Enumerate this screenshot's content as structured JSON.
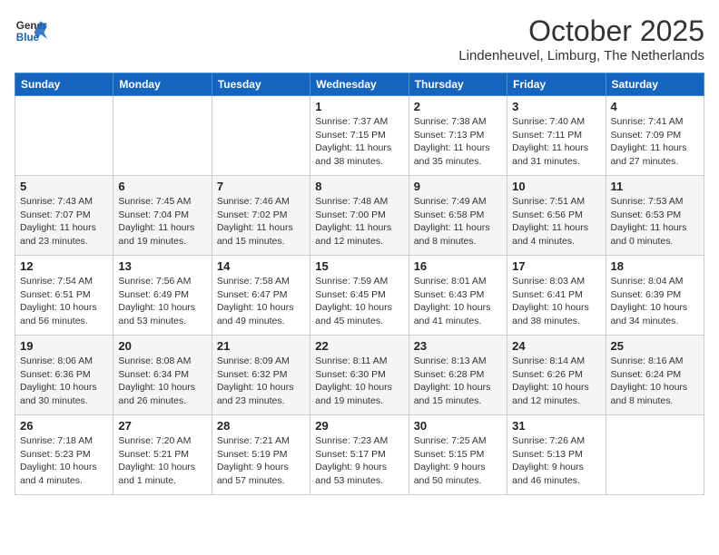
{
  "header": {
    "logo_line1": "General",
    "logo_line2": "Blue",
    "month": "October 2025",
    "location": "Lindenheuvel, Limburg, The Netherlands"
  },
  "weekdays": [
    "Sunday",
    "Monday",
    "Tuesday",
    "Wednesday",
    "Thursday",
    "Friday",
    "Saturday"
  ],
  "weeks": [
    [
      {
        "day": "",
        "info": ""
      },
      {
        "day": "",
        "info": ""
      },
      {
        "day": "",
        "info": ""
      },
      {
        "day": "1",
        "info": "Sunrise: 7:37 AM\nSunset: 7:15 PM\nDaylight: 11 hours\nand 38 minutes."
      },
      {
        "day": "2",
        "info": "Sunrise: 7:38 AM\nSunset: 7:13 PM\nDaylight: 11 hours\nand 35 minutes."
      },
      {
        "day": "3",
        "info": "Sunrise: 7:40 AM\nSunset: 7:11 PM\nDaylight: 11 hours\nand 31 minutes."
      },
      {
        "day": "4",
        "info": "Sunrise: 7:41 AM\nSunset: 7:09 PM\nDaylight: 11 hours\nand 27 minutes."
      }
    ],
    [
      {
        "day": "5",
        "info": "Sunrise: 7:43 AM\nSunset: 7:07 PM\nDaylight: 11 hours\nand 23 minutes."
      },
      {
        "day": "6",
        "info": "Sunrise: 7:45 AM\nSunset: 7:04 PM\nDaylight: 11 hours\nand 19 minutes."
      },
      {
        "day": "7",
        "info": "Sunrise: 7:46 AM\nSunset: 7:02 PM\nDaylight: 11 hours\nand 15 minutes."
      },
      {
        "day": "8",
        "info": "Sunrise: 7:48 AM\nSunset: 7:00 PM\nDaylight: 11 hours\nand 12 minutes."
      },
      {
        "day": "9",
        "info": "Sunrise: 7:49 AM\nSunset: 6:58 PM\nDaylight: 11 hours\nand 8 minutes."
      },
      {
        "day": "10",
        "info": "Sunrise: 7:51 AM\nSunset: 6:56 PM\nDaylight: 11 hours\nand 4 minutes."
      },
      {
        "day": "11",
        "info": "Sunrise: 7:53 AM\nSunset: 6:53 PM\nDaylight: 11 hours\nand 0 minutes."
      }
    ],
    [
      {
        "day": "12",
        "info": "Sunrise: 7:54 AM\nSunset: 6:51 PM\nDaylight: 10 hours\nand 56 minutes."
      },
      {
        "day": "13",
        "info": "Sunrise: 7:56 AM\nSunset: 6:49 PM\nDaylight: 10 hours\nand 53 minutes."
      },
      {
        "day": "14",
        "info": "Sunrise: 7:58 AM\nSunset: 6:47 PM\nDaylight: 10 hours\nand 49 minutes."
      },
      {
        "day": "15",
        "info": "Sunrise: 7:59 AM\nSunset: 6:45 PM\nDaylight: 10 hours\nand 45 minutes."
      },
      {
        "day": "16",
        "info": "Sunrise: 8:01 AM\nSunset: 6:43 PM\nDaylight: 10 hours\nand 41 minutes."
      },
      {
        "day": "17",
        "info": "Sunrise: 8:03 AM\nSunset: 6:41 PM\nDaylight: 10 hours\nand 38 minutes."
      },
      {
        "day": "18",
        "info": "Sunrise: 8:04 AM\nSunset: 6:39 PM\nDaylight: 10 hours\nand 34 minutes."
      }
    ],
    [
      {
        "day": "19",
        "info": "Sunrise: 8:06 AM\nSunset: 6:36 PM\nDaylight: 10 hours\nand 30 minutes."
      },
      {
        "day": "20",
        "info": "Sunrise: 8:08 AM\nSunset: 6:34 PM\nDaylight: 10 hours\nand 26 minutes."
      },
      {
        "day": "21",
        "info": "Sunrise: 8:09 AM\nSunset: 6:32 PM\nDaylight: 10 hours\nand 23 minutes."
      },
      {
        "day": "22",
        "info": "Sunrise: 8:11 AM\nSunset: 6:30 PM\nDaylight: 10 hours\nand 19 minutes."
      },
      {
        "day": "23",
        "info": "Sunrise: 8:13 AM\nSunset: 6:28 PM\nDaylight: 10 hours\nand 15 minutes."
      },
      {
        "day": "24",
        "info": "Sunrise: 8:14 AM\nSunset: 6:26 PM\nDaylight: 10 hours\nand 12 minutes."
      },
      {
        "day": "25",
        "info": "Sunrise: 8:16 AM\nSunset: 6:24 PM\nDaylight: 10 hours\nand 8 minutes."
      }
    ],
    [
      {
        "day": "26",
        "info": "Sunrise: 7:18 AM\nSunset: 5:23 PM\nDaylight: 10 hours\nand 4 minutes."
      },
      {
        "day": "27",
        "info": "Sunrise: 7:20 AM\nSunset: 5:21 PM\nDaylight: 10 hours\nand 1 minute."
      },
      {
        "day": "28",
        "info": "Sunrise: 7:21 AM\nSunset: 5:19 PM\nDaylight: 9 hours\nand 57 minutes."
      },
      {
        "day": "29",
        "info": "Sunrise: 7:23 AM\nSunset: 5:17 PM\nDaylight: 9 hours\nand 53 minutes."
      },
      {
        "day": "30",
        "info": "Sunrise: 7:25 AM\nSunset: 5:15 PM\nDaylight: 9 hours\nand 50 minutes."
      },
      {
        "day": "31",
        "info": "Sunrise: 7:26 AM\nSunset: 5:13 PM\nDaylight: 9 hours\nand 46 minutes."
      },
      {
        "day": "",
        "info": ""
      }
    ]
  ]
}
